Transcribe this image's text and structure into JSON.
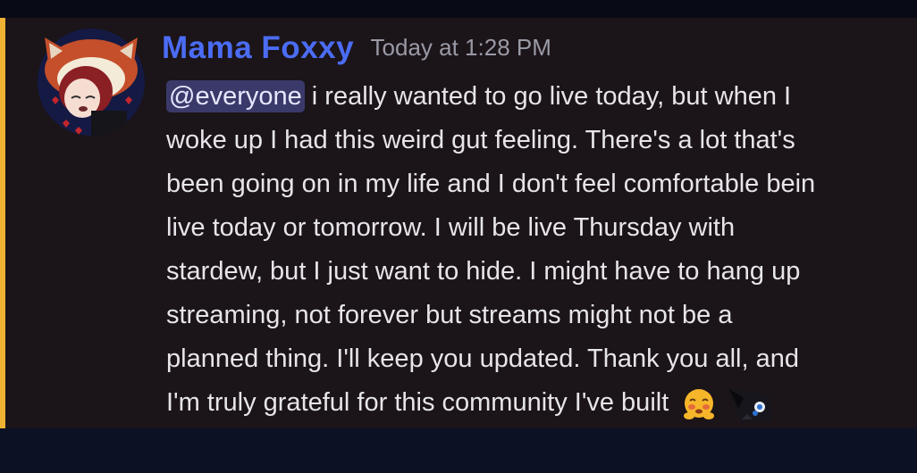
{
  "message": {
    "author": "Mama Foxxy",
    "timestamp": "Today at 1:28 PM",
    "mention": "@everyone",
    "lines": [
      " i really wanted to go live today, but when I",
      "woke up I had this weird gut feeling. There's a lot that's",
      "been going on in my life and I don't feel comfortable bein",
      "live today or tomorrow. I will be live Thursday with",
      "stardew, but I just want to hide. I might have to hang up",
      "streaming, not forever but streams might not be a",
      "planned thing.  I'll keep you updated. Thank you all, and",
      "I'm truly grateful for this community I've built"
    ],
    "emojis": [
      "blushing-face-emoji",
      "custom-fox-emoji"
    ]
  },
  "colors": {
    "author": "#4b6cf5",
    "mention_bg": "#3a3a6a",
    "highlight_bar": "#f0b232",
    "message_bg": "#1b1419"
  }
}
